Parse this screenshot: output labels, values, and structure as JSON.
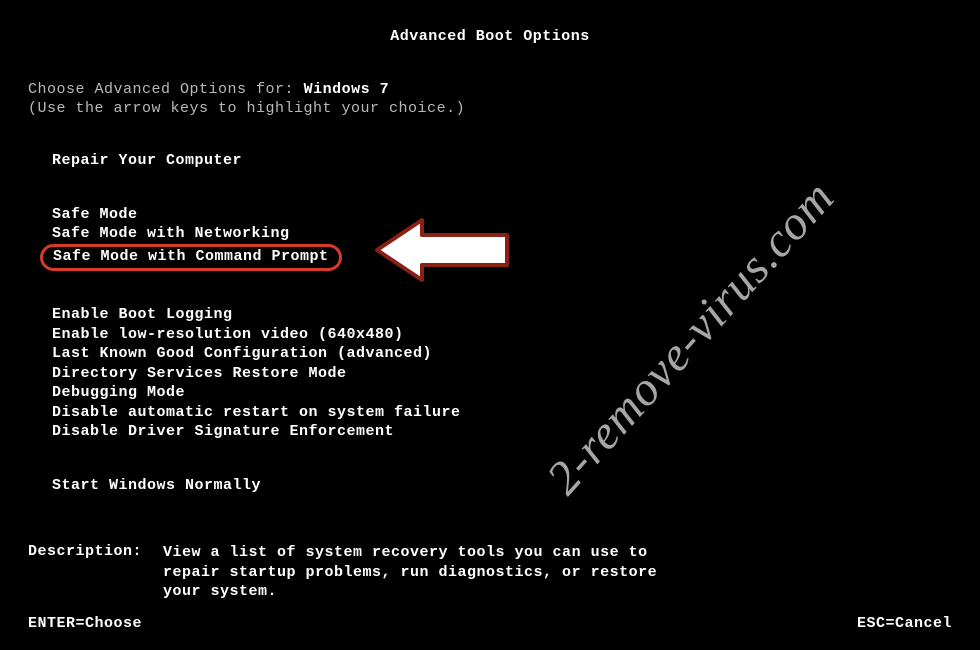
{
  "title": "Advanced Boot Options",
  "prompt": {
    "choose_label": "Choose Advanced Options for:",
    "os_name": "Windows 7",
    "hint": "(Use the arrow keys to highlight your choice.)"
  },
  "repair_option": "Repair Your Computer",
  "safe_modes": [
    "Safe Mode",
    "Safe Mode with Networking",
    "Safe Mode with Command Prompt"
  ],
  "highlighted_index": 2,
  "advanced_options": [
    "Enable Boot Logging",
    "Enable low-resolution video (640x480)",
    "Last Known Good Configuration (advanced)",
    "Directory Services Restore Mode",
    "Debugging Mode",
    "Disable automatic restart on system failure",
    "Disable Driver Signature Enforcement"
  ],
  "normal_option": "Start Windows Normally",
  "description": {
    "label": "Description:",
    "text": "View a list of system recovery tools you can use to repair startup problems, run diagnostics, or restore your system."
  },
  "footer": {
    "enter": "ENTER=Choose",
    "esc": "ESC=Cancel"
  },
  "watermark": "2-remove-virus.com",
  "colors": {
    "highlight_border": "#d63a2b",
    "text_primary": "#ffffff",
    "text_dim": "#b8b8b8",
    "background": "#000000"
  }
}
